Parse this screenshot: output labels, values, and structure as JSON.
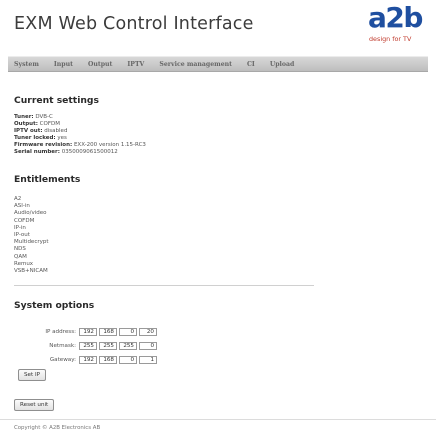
{
  "header": {
    "title": "EXM Web Control Interface",
    "logo_text": "a2b",
    "logo_tagline": "design for TV",
    "logo_color": "#1f4fa0",
    "tagline_color": "#c0392b"
  },
  "nav": {
    "items": [
      "System",
      "Input",
      "Output",
      "IPTV",
      "Service management",
      "CI",
      "Upload"
    ]
  },
  "current_settings": {
    "heading": "Current settings",
    "rows": [
      {
        "label": "Tuner:",
        "value": "DVB-C"
      },
      {
        "label": "Output:",
        "value": "COFDM"
      },
      {
        "label": "IPTV out:",
        "value": "disabled"
      },
      {
        "label": "Tuner locked:",
        "value": "yes"
      },
      {
        "label": "Firmware revision:",
        "value": "EXX-200 version 1.15-RC3"
      },
      {
        "label": "Serial number:",
        "value": "0350009061500012"
      }
    ]
  },
  "entitlements": {
    "heading": "Entitlements",
    "items": [
      "A2",
      "ASI-in",
      "Audio/video",
      "COFDM",
      "IP-in",
      "IP-out",
      "Multidecrypt",
      "NDS",
      "QAM",
      "Remux",
      "VSB+NICAM"
    ]
  },
  "system_options": {
    "heading": "System options",
    "ip_address": {
      "label": "IP address:",
      "octets": [
        "192",
        "168",
        "0",
        "20"
      ]
    },
    "netmask": {
      "label": "Netmask:",
      "octets": [
        "255",
        "255",
        "255",
        "0"
      ]
    },
    "gateway": {
      "label": "Gateway:",
      "octets": [
        "192",
        "168",
        "0",
        "1"
      ]
    },
    "set_ip_label": "Set IP"
  },
  "reset_label": "Reset unit",
  "footer": {
    "copyright": "Copyright © A2B Electronics AB"
  }
}
